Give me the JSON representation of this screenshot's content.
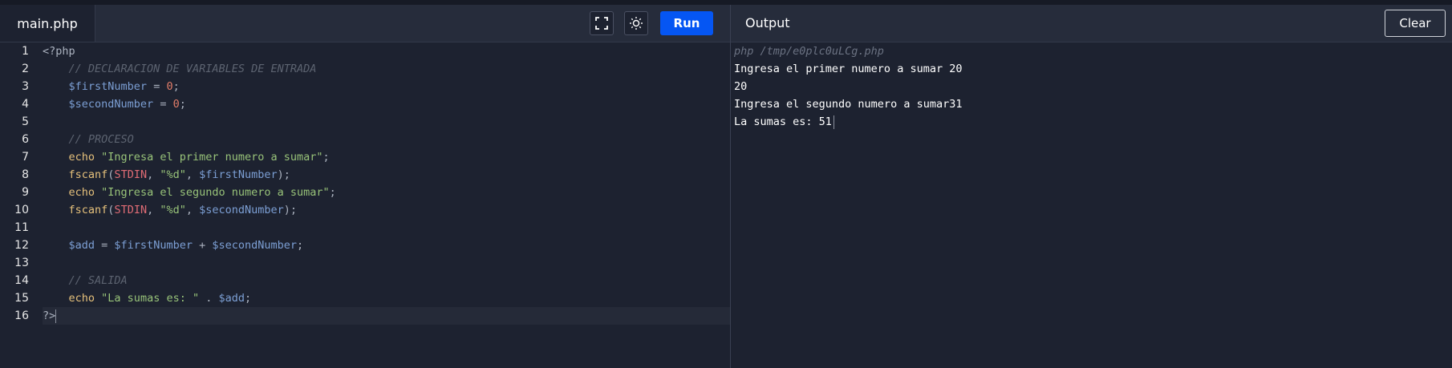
{
  "editor": {
    "tab_label": "main.php",
    "run_label": "Run",
    "fullscreen_icon": "fullscreen-icon",
    "theme_icon": "sun-icon",
    "lines": [
      {
        "num": "1",
        "tokens": [
          {
            "t": "<?php",
            "c": "plain"
          }
        ]
      },
      {
        "num": "2",
        "tokens": [
          {
            "t": "    ",
            "c": "plain"
          },
          {
            "t": "// DECLARACION DE VARIABLES DE ENTRADA",
            "c": "comment"
          }
        ]
      },
      {
        "num": "3",
        "tokens": [
          {
            "t": "    ",
            "c": "plain"
          },
          {
            "t": "$firstNumber",
            "c": "var"
          },
          {
            "t": " = ",
            "c": "op"
          },
          {
            "t": "0",
            "c": "num"
          },
          {
            "t": ";",
            "c": "op"
          }
        ]
      },
      {
        "num": "4",
        "tokens": [
          {
            "t": "    ",
            "c": "plain"
          },
          {
            "t": "$secondNumber",
            "c": "var"
          },
          {
            "t": " = ",
            "c": "op"
          },
          {
            "t": "0",
            "c": "num"
          },
          {
            "t": ";",
            "c": "op"
          }
        ]
      },
      {
        "num": "5",
        "tokens": []
      },
      {
        "num": "6",
        "tokens": [
          {
            "t": "    ",
            "c": "plain"
          },
          {
            "t": "// PROCESO",
            "c": "comment"
          }
        ]
      },
      {
        "num": "7",
        "tokens": [
          {
            "t": "    ",
            "c": "plain"
          },
          {
            "t": "echo",
            "c": "kw"
          },
          {
            "t": " ",
            "c": "plain"
          },
          {
            "t": "\"Ingresa el primer numero a sumar\"",
            "c": "str"
          },
          {
            "t": ";",
            "c": "op"
          }
        ]
      },
      {
        "num": "8",
        "tokens": [
          {
            "t": "    ",
            "c": "plain"
          },
          {
            "t": "fscanf",
            "c": "kw"
          },
          {
            "t": "(",
            "c": "op"
          },
          {
            "t": "STDIN",
            "c": "const"
          },
          {
            "t": ", ",
            "c": "op"
          },
          {
            "t": "\"%d\"",
            "c": "str"
          },
          {
            "t": ", ",
            "c": "op"
          },
          {
            "t": "$firstNumber",
            "c": "var"
          },
          {
            "t": ");",
            "c": "op"
          }
        ]
      },
      {
        "num": "9",
        "tokens": [
          {
            "t": "    ",
            "c": "plain"
          },
          {
            "t": "echo",
            "c": "kw"
          },
          {
            "t": " ",
            "c": "plain"
          },
          {
            "t": "\"Ingresa el segundo numero a sumar\"",
            "c": "str"
          },
          {
            "t": ";",
            "c": "op"
          }
        ]
      },
      {
        "num": "10",
        "tokens": [
          {
            "t": "    ",
            "c": "plain"
          },
          {
            "t": "fscanf",
            "c": "kw"
          },
          {
            "t": "(",
            "c": "op"
          },
          {
            "t": "STDIN",
            "c": "const"
          },
          {
            "t": ", ",
            "c": "op"
          },
          {
            "t": "\"%d\"",
            "c": "str"
          },
          {
            "t": ", ",
            "c": "op"
          },
          {
            "t": "$secondNumber",
            "c": "var"
          },
          {
            "t": ");",
            "c": "op"
          }
        ]
      },
      {
        "num": "11",
        "tokens": []
      },
      {
        "num": "12",
        "tokens": [
          {
            "t": "    ",
            "c": "plain"
          },
          {
            "t": "$add",
            "c": "var"
          },
          {
            "t": " = ",
            "c": "op"
          },
          {
            "t": "$firstNumber",
            "c": "var"
          },
          {
            "t": " + ",
            "c": "op"
          },
          {
            "t": "$secondNumber",
            "c": "var"
          },
          {
            "t": ";",
            "c": "op"
          }
        ]
      },
      {
        "num": "13",
        "tokens": []
      },
      {
        "num": "14",
        "tokens": [
          {
            "t": "    ",
            "c": "plain"
          },
          {
            "t": "// SALIDA",
            "c": "comment"
          }
        ]
      },
      {
        "num": "15",
        "tokens": [
          {
            "t": "    ",
            "c": "plain"
          },
          {
            "t": "echo",
            "c": "kw"
          },
          {
            "t": " ",
            "c": "plain"
          },
          {
            "t": "\"La sumas es: \"",
            "c": "str"
          },
          {
            "t": " . ",
            "c": "op"
          },
          {
            "t": "$add",
            "c": "var"
          },
          {
            "t": ";",
            "c": "op"
          }
        ]
      },
      {
        "num": "16",
        "tokens": [
          {
            "t": "?>",
            "c": "plain"
          }
        ],
        "active": true
      }
    ]
  },
  "output": {
    "title": "Output",
    "clear_label": "Clear",
    "command": "php /tmp/e0plc0uLCg.php",
    "lines": [
      "Ingresa el primer numero a sumar 20",
      "20",
      "Ingresa el segundo numero a sumar31",
      "La sumas es: 51"
    ]
  },
  "colors": {
    "background": "#1d2230",
    "toolbar": "#262c3b",
    "run_button": "#0556f3",
    "comment": "#5c6370",
    "variable": "#7c9fd4",
    "keyword": "#e5c07b",
    "string": "#98c379",
    "number": "#e07c68"
  }
}
